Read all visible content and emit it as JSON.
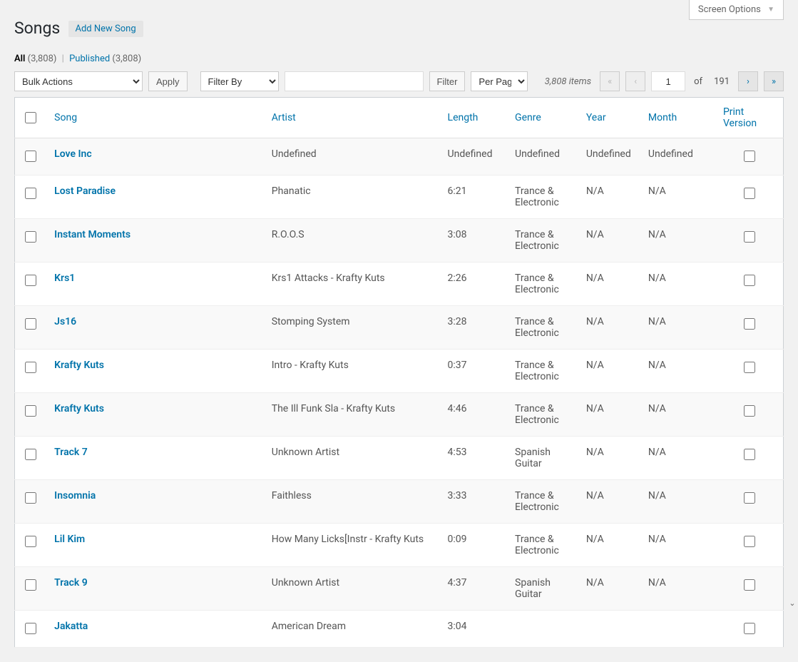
{
  "screenOptions": {
    "label": "Screen Options"
  },
  "title": "Songs",
  "addNew": "Add New Song",
  "filters": {
    "all_label": "All",
    "all_count": "(3,808)",
    "sep": "|",
    "published_label": "Published",
    "published_count": "(3,808)"
  },
  "toolbar": {
    "bulkActions": "Bulk Actions",
    "apply": "Apply",
    "filterBy": "Filter By",
    "filterBtn": "Filter",
    "perPage": "Per Page"
  },
  "pagination": {
    "itemsText": "3,808 items",
    "current": "1",
    "ofLabel": "of",
    "total": "191",
    "first": "«",
    "prev": "‹",
    "next": "›",
    "last": "»"
  },
  "columns": {
    "song": "Song",
    "artist": "Artist",
    "length": "Length",
    "genre": "Genre",
    "year": "Year",
    "month": "Month",
    "print": "Print Version"
  },
  "rows": [
    {
      "song": "Love Inc",
      "artist": "Undefined",
      "length": "Undefined",
      "genre": "Undefined",
      "year": "Undefined",
      "month": "Undefined"
    },
    {
      "song": "Lost Paradise",
      "artist": "Phanatic",
      "length": "6:21",
      "genre": "Trance & Electronic",
      "year": "N/A",
      "month": "N/A"
    },
    {
      "song": "Instant Moments",
      "artist": "R.O.O.S",
      "length": "3:08",
      "genre": "Trance & Electronic",
      "year": "N/A",
      "month": "N/A"
    },
    {
      "song": "Krs1",
      "artist": "Krs1 Attacks - Krafty Kuts",
      "length": "2:26",
      "genre": "Trance & Electronic",
      "year": "N/A",
      "month": "N/A"
    },
    {
      "song": "Js16",
      "artist": "Stomping System",
      "length": "3:28",
      "genre": "Trance & Electronic",
      "year": "N/A",
      "month": "N/A"
    },
    {
      "song": "Krafty Kuts",
      "artist": "Intro - Krafty Kuts",
      "length": "0:37",
      "genre": "Trance & Electronic",
      "year": "N/A",
      "month": "N/A"
    },
    {
      "song": "Krafty Kuts",
      "artist": "The Ill Funk Sla - Krafty Kuts",
      "length": "4:46",
      "genre": "Trance & Electronic",
      "year": "N/A",
      "month": "N/A"
    },
    {
      "song": "Track 7",
      "artist": "Unknown Artist",
      "length": "4:53",
      "genre": "Spanish Guitar",
      "year": "N/A",
      "month": "N/A"
    },
    {
      "song": "Insomnia",
      "artist": "Faithless",
      "length": "3:33",
      "genre": "Trance & Electronic",
      "year": "N/A",
      "month": "N/A"
    },
    {
      "song": "Lil Kim",
      "artist": "How Many Licks[Instr - Krafty Kuts",
      "length": "0:09",
      "genre": "Trance & Electronic",
      "year": "N/A",
      "month": "N/A"
    },
    {
      "song": "Track 9",
      "artist": "Unknown Artist",
      "length": "4:37",
      "genre": "Spanish Guitar",
      "year": "N/A",
      "month": "N/A"
    },
    {
      "song": "Jakatta",
      "artist": "American Dream",
      "length": "3:04",
      "genre": "",
      "year": "",
      "month": ""
    }
  ]
}
